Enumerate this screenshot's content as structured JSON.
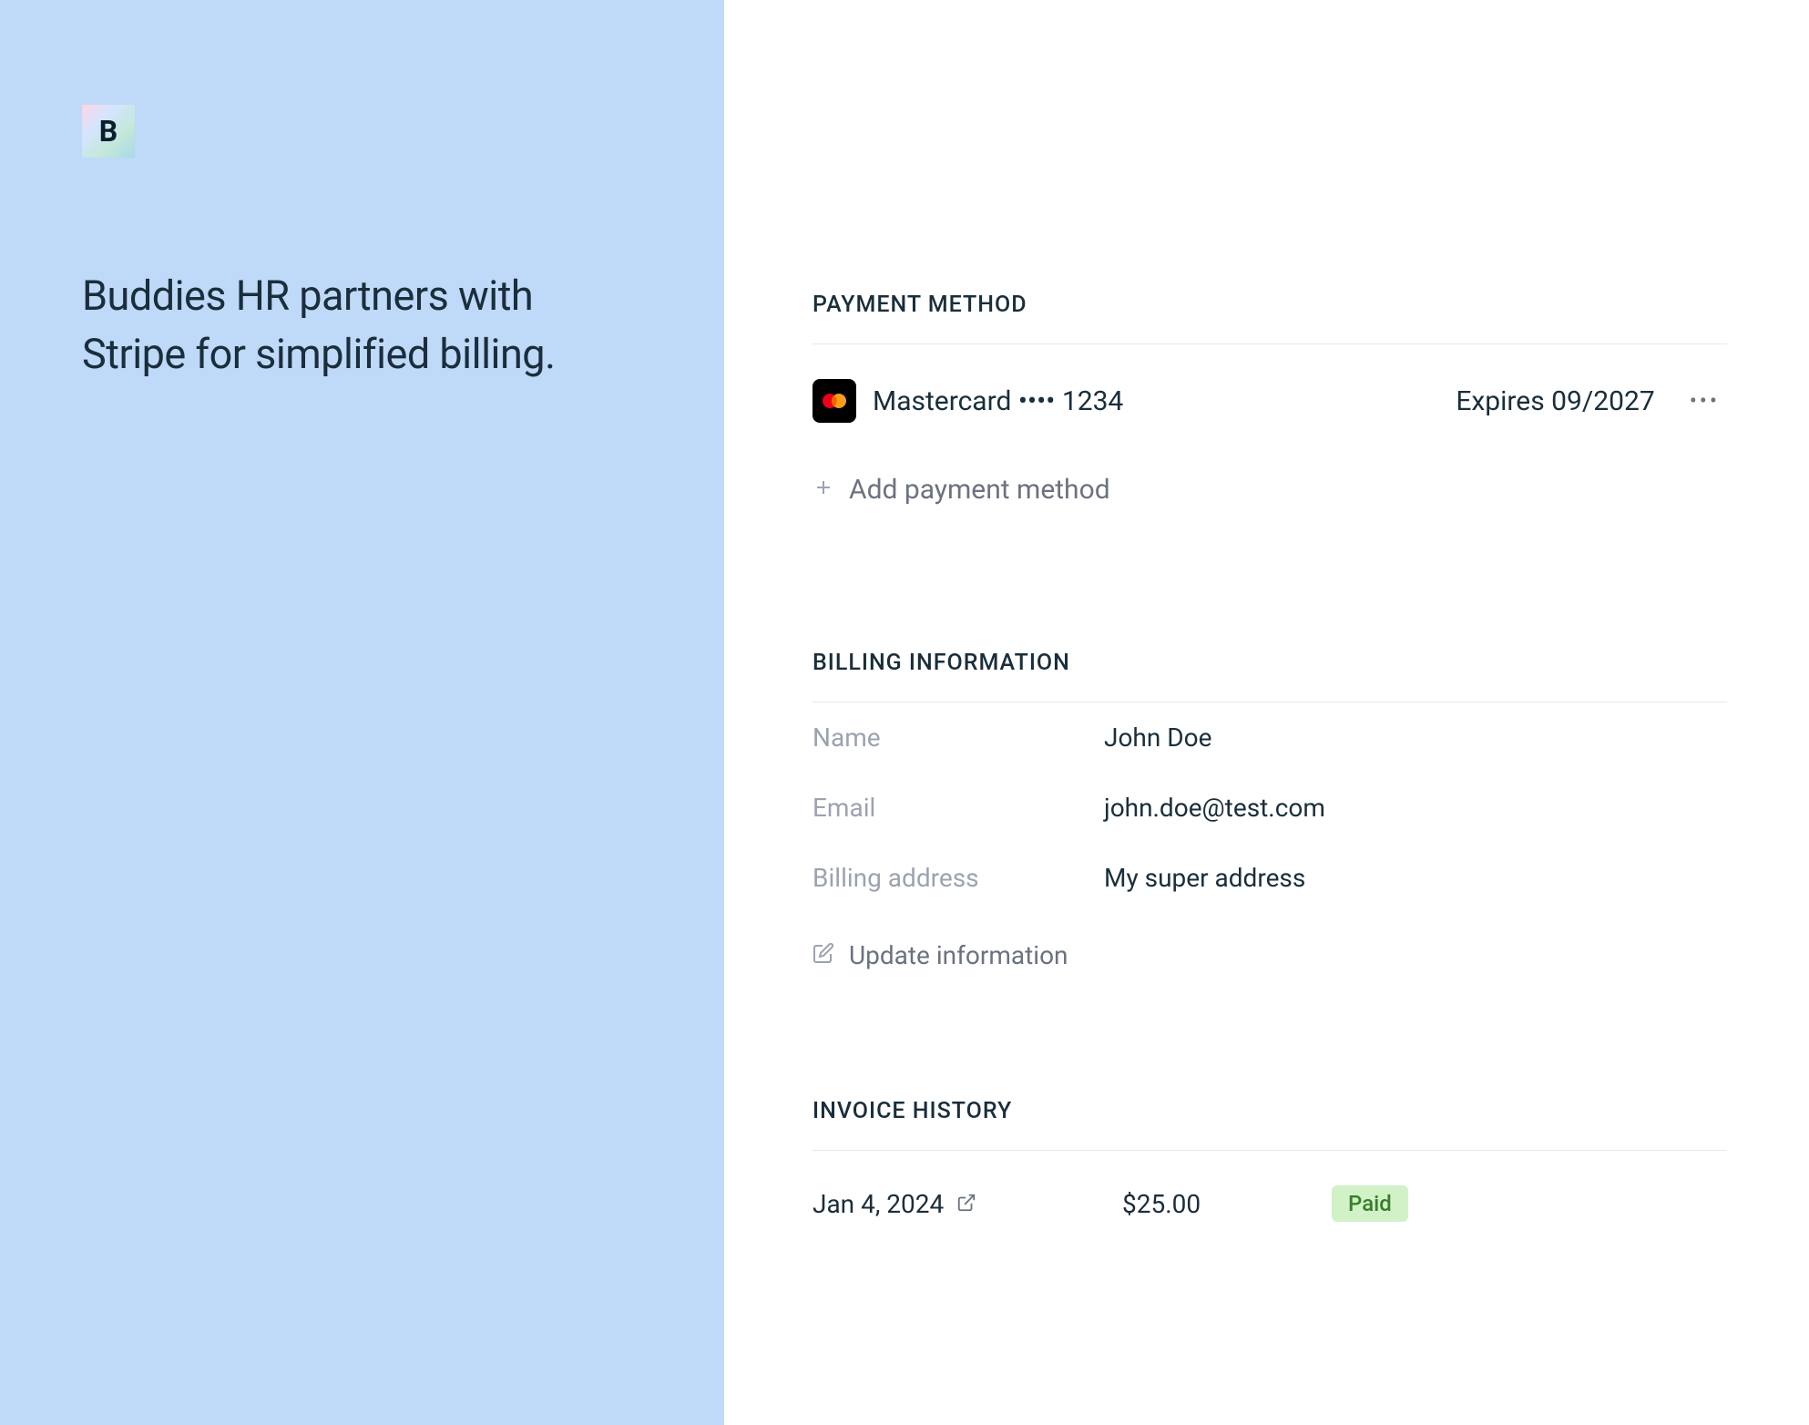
{
  "sidebar": {
    "logo_text": "B",
    "heading": "Buddies HR partners with Stripe for simplified billing."
  },
  "payment_method": {
    "section_title": "PAYMENT METHOD",
    "card_brand": "Mastercard",
    "card_dots": "••••",
    "card_last4": "1234",
    "expires_label": "Expires",
    "expires_date": "09/2027",
    "add_label": "Add payment method"
  },
  "billing_info": {
    "section_title": "BILLING INFORMATION",
    "name_label": "Name",
    "name_value": "John Doe",
    "email_label": "Email",
    "email_value": "john.doe@test.com",
    "address_label": "Billing address",
    "address_value": "My super address",
    "update_label": "Update information"
  },
  "invoice_history": {
    "section_title": "INVOICE HISTORY",
    "items": [
      {
        "date": "Jan 4, 2024",
        "amount": "$25.00",
        "status": "Paid"
      }
    ]
  }
}
